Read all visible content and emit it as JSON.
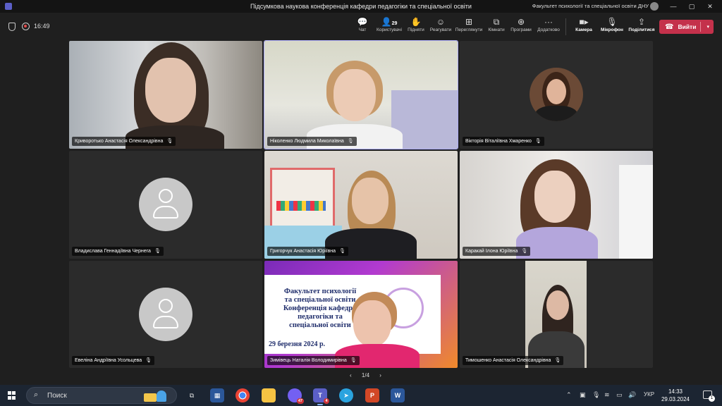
{
  "window": {
    "title": "Підсумкова наукова конференція кафедри педагогіки та спеціальної освіти",
    "org": "Факультет психології та спеціальної освіти ДНУ",
    "controls": [
      "—",
      "▢",
      "✕"
    ]
  },
  "toolbar": {
    "timer": "16:49",
    "buttons": [
      {
        "id": "chat",
        "label": "Чат",
        "icon": "chat-icon"
      },
      {
        "id": "people",
        "label": "Користувачі",
        "icon": "people-icon",
        "count": "29"
      },
      {
        "id": "raise",
        "label": "Підняти",
        "icon": "hand-icon"
      },
      {
        "id": "react",
        "label": "Реагувати",
        "icon": "smile-icon"
      },
      {
        "id": "view",
        "label": "Переглянути",
        "icon": "grid-icon"
      },
      {
        "id": "rooms",
        "label": "Кімнати",
        "icon": "rooms-icon"
      },
      {
        "id": "apps",
        "label": "Програми",
        "icon": "plus-icon"
      },
      {
        "id": "more",
        "label": "Додатково",
        "icon": "more-icon"
      },
      {
        "id": "camera",
        "label": "Камера",
        "icon": "camera-icon"
      },
      {
        "id": "mic",
        "label": "Мікрофон",
        "icon": "mic-off-icon"
      },
      {
        "id": "share",
        "label": "Поділитися",
        "icon": "share-icon"
      }
    ],
    "leave_label": "Вийти"
  },
  "participants": [
    {
      "name": "Криворотько Анастасія Олександрівна"
    },
    {
      "name": "Ніколенко Людмила Миколаївна"
    },
    {
      "name": "Вікторія Віталіївна Хмаренко"
    },
    {
      "name": "Владислава Геннадіївна Чернега"
    },
    {
      "name": "Григорчук Анастасія Юріївна"
    },
    {
      "name": "Каракай Ілона Юріївна"
    },
    {
      "name": "Евеліна Андріївна Усольцева"
    },
    {
      "name": "Зимівець Наталія Володимирівна"
    },
    {
      "name": "Тимошенко Анастасія Олександрівна"
    }
  ],
  "slide": {
    "lines": [
      "Факультет психології",
      "та спеціальної освіти",
      "Конференція кафедри",
      "педагогіки та",
      "спеціальної освіти"
    ],
    "date": "29  березня 2024 р."
  },
  "pager": {
    "text": "1/4",
    "prev": "‹",
    "next": "›"
  },
  "taskbar": {
    "search_placeholder": "Поиск",
    "lang": "УКР",
    "time": "14:33",
    "date": "29.03.2024",
    "viber_badge": "47",
    "teams_badge": "4",
    "notif_count": "1"
  }
}
